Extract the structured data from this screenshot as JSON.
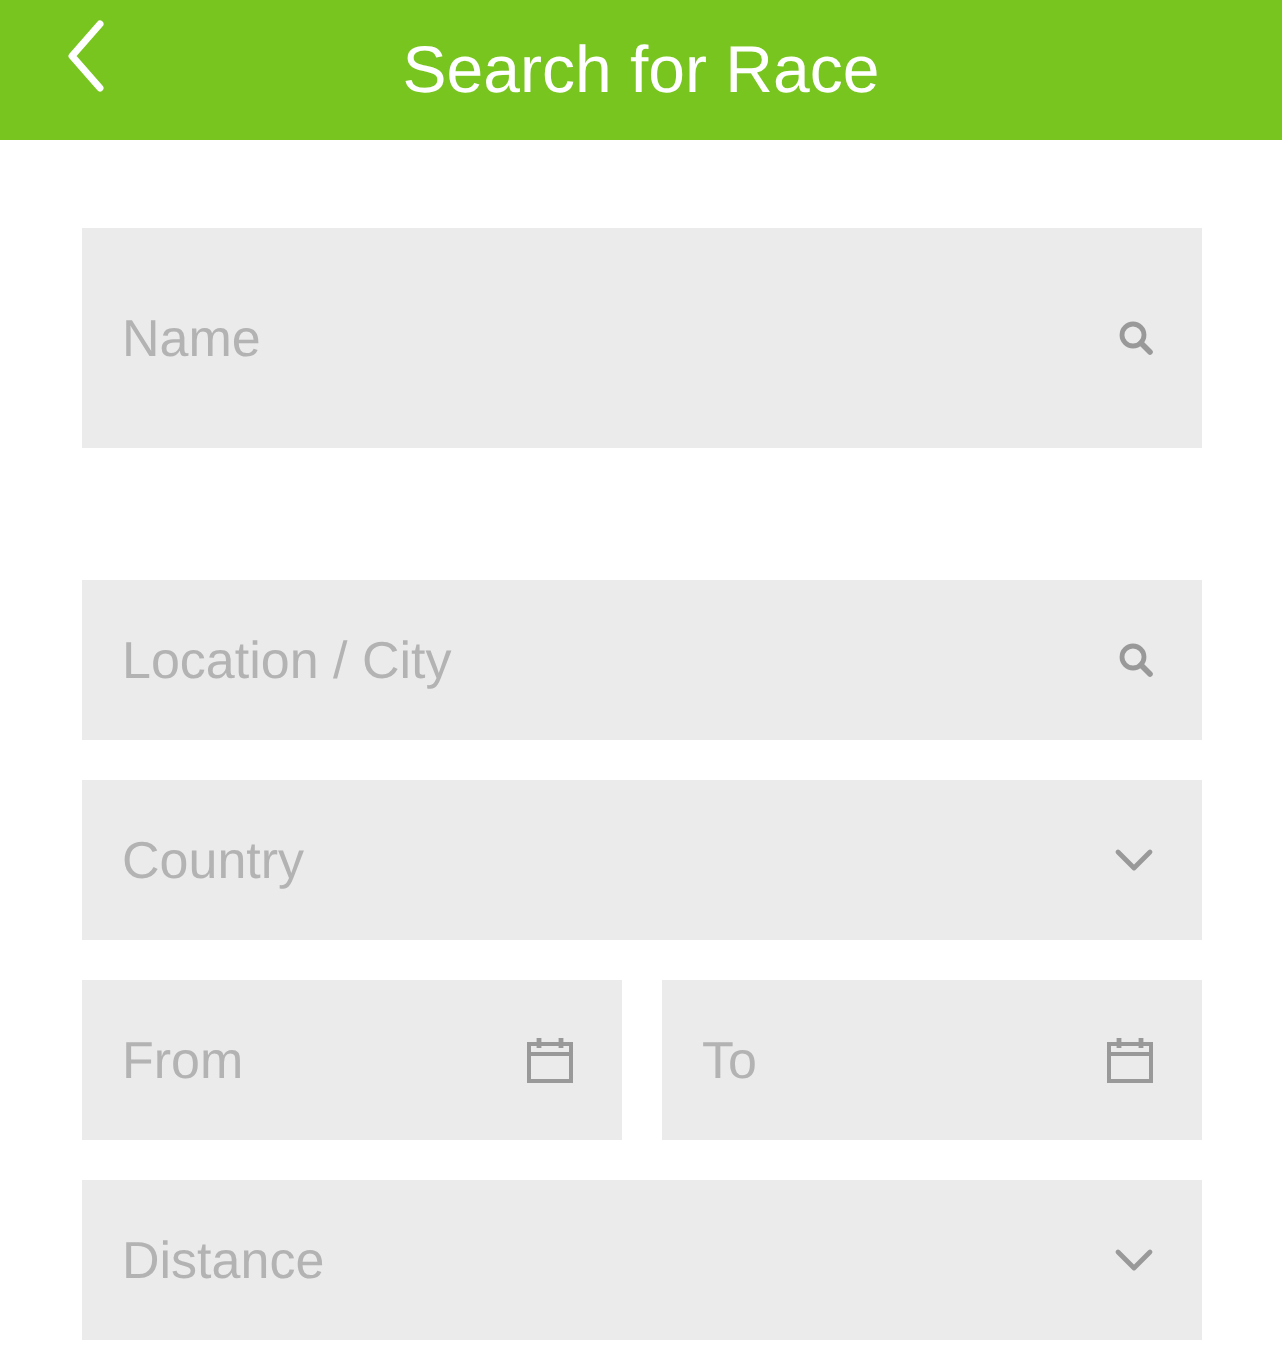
{
  "header": {
    "title": "Search for Race"
  },
  "name_field": {
    "placeholder": "Name",
    "kind": "search"
  },
  "filter_rows": [
    [
      {
        "placeholder": "Location / City",
        "kind": "search"
      }
    ],
    [
      {
        "placeholder": "Country",
        "kind": "select"
      }
    ],
    [
      {
        "placeholder": "From",
        "kind": "date"
      },
      {
        "placeholder": "To",
        "kind": "date"
      }
    ],
    [
      {
        "placeholder": "Distance",
        "kind": "select"
      }
    ]
  ]
}
